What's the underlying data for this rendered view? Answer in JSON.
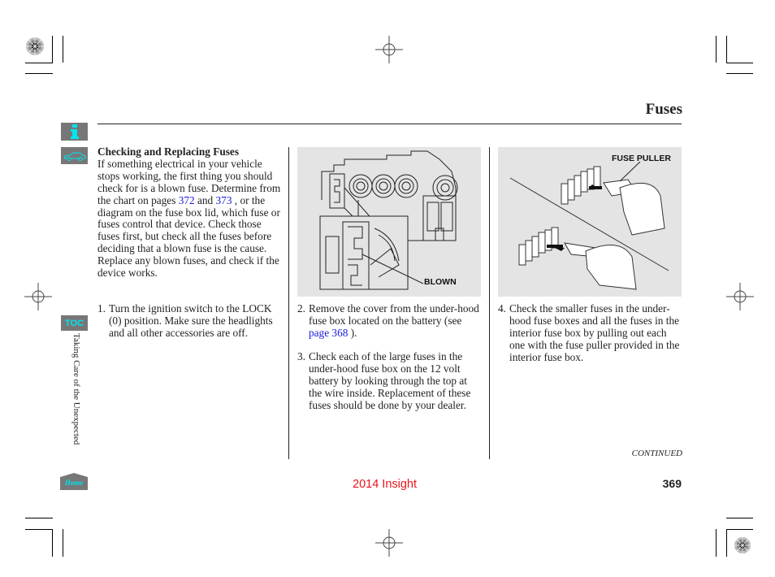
{
  "header": {
    "title": "Fuses"
  },
  "sidebar": {
    "icons": [
      {
        "name": "info-icon",
        "color": "#00e5ee"
      },
      {
        "name": "car-icon",
        "color": "#00e5ee"
      }
    ],
    "toc_label": "TOC",
    "section_label": "Taking Care of the Unexpected",
    "home_label": "Home"
  },
  "column1": {
    "heading": "Checking and Replacing Fuses",
    "intro_before_links": "If something electrical in your vehicle stops working, the first thing you should check for is a blown fuse. Determine from the chart on pages",
    "link_372": "372",
    "and_word": "and",
    "link_373": "373",
    "intro_after_links": ", or the diagram on the fuse box lid, which fuse or fuses control that device. Check those fuses first, but check all the fuses before deciding that a blown fuse is the cause. Replace any blown fuses, and check if the device works.",
    "step1_num": "1.",
    "step1_text": "Turn the ignition switch to the LOCK (0) position. Make sure the headlights and all other accessories are off."
  },
  "column2": {
    "figure_label": "BLOWN",
    "step2_num": "2.",
    "step2_before_link": "Remove the cover from the under-hood fuse box located on the battery (see",
    "step2_link": "page 368",
    "step2_after_link": ").",
    "step3_num": "3.",
    "step3_text": "Check each of the large fuses in the under-hood fuse box on the 12 volt battery by looking through the top at the wire inside. Replacement of these fuses should be done by your dealer."
  },
  "column3": {
    "figure_label": "FUSE PULLER",
    "step4_num": "4.",
    "step4_text": "Check the smaller fuses in the under-hood fuse boxes and all the fuses in the interior fuse box by pulling out each one with the fuse puller provided in the interior fuse box."
  },
  "footer": {
    "continued": "CONTINUED",
    "model": "2014 Insight",
    "page_number": "369"
  },
  "colors": {
    "link": "#1a1adc",
    "model_text": "#e8141c",
    "nav_accent": "#00e5ee",
    "nav_bg": "#777777",
    "figure_bg": "#e4e4e4"
  }
}
